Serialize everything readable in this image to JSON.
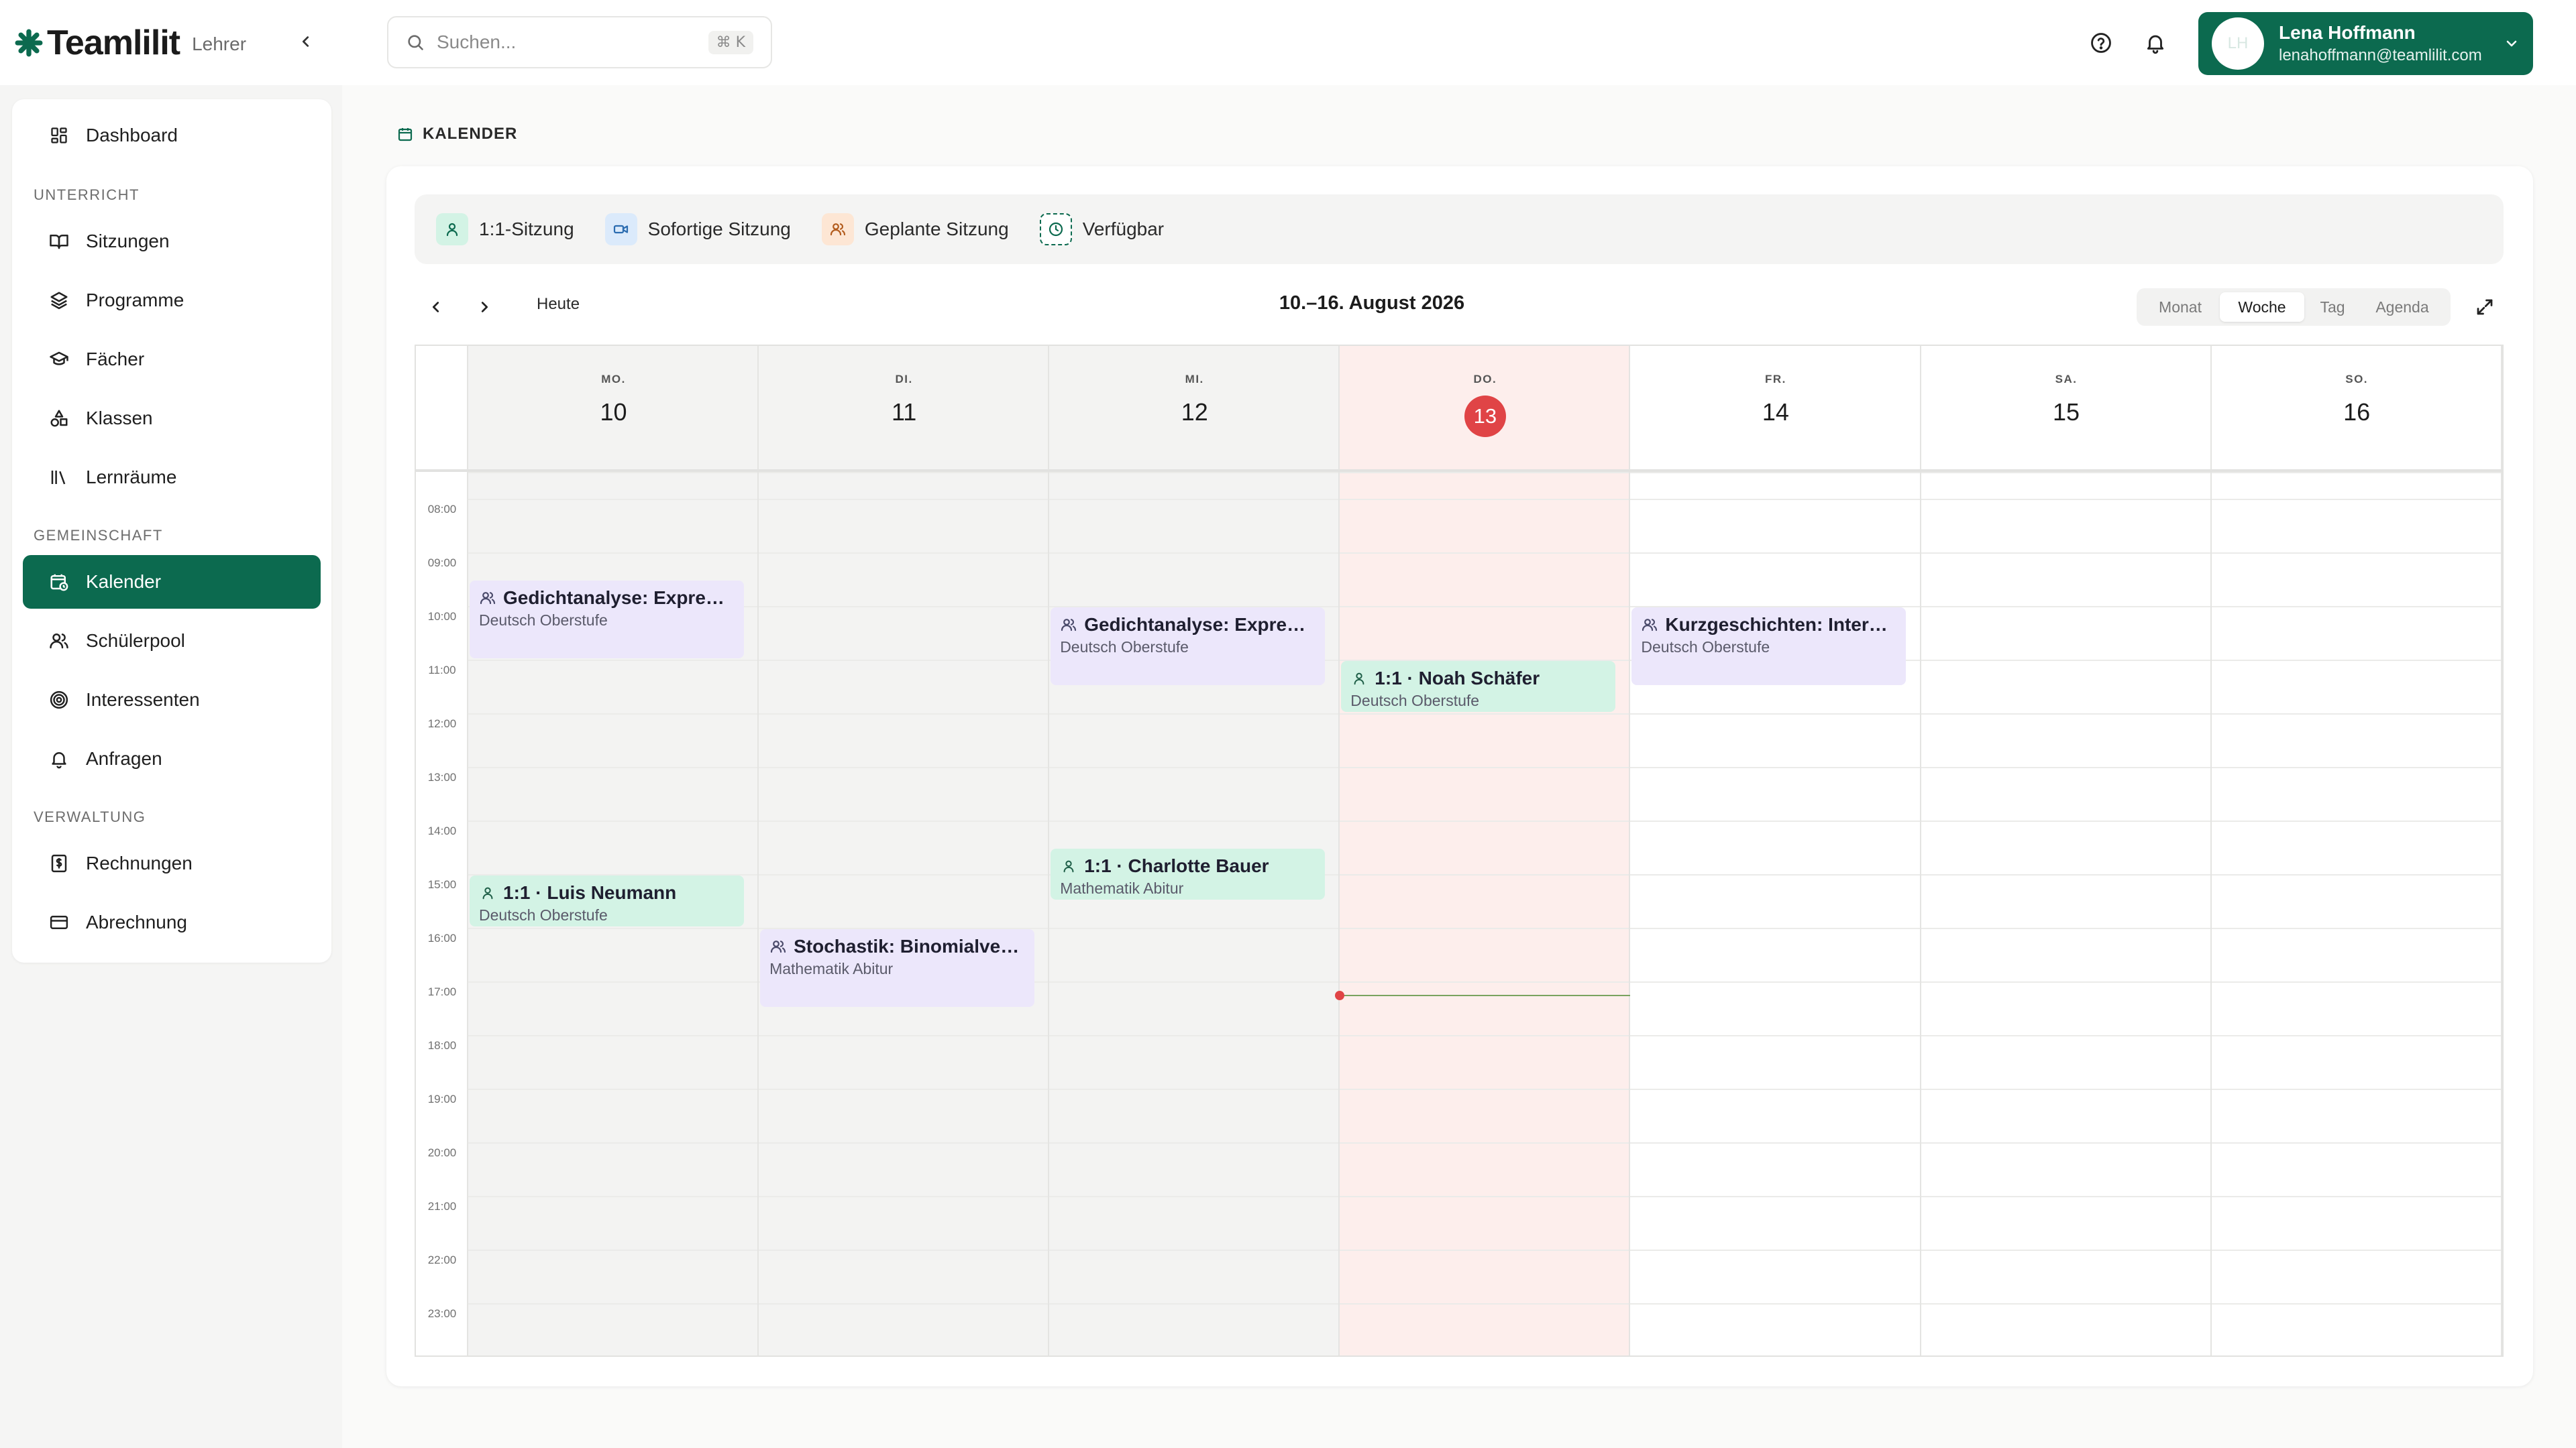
{
  "app": {
    "name": "Teamlilit",
    "role": "Lehrer"
  },
  "search": {
    "placeholder": "Suchen...",
    "shortcut": "⌘ K"
  },
  "user": {
    "initials": "LH",
    "name": "Lena Hoffmann",
    "email": "lenahoffmann@teamlilit.com"
  },
  "sidebar": {
    "top_items": [
      {
        "label": "Dashboard",
        "icon": "dashboard-icon"
      }
    ],
    "sections": [
      {
        "title": "UNTERRICHT",
        "items": [
          {
            "label": "Sitzungen",
            "icon": "book-open-icon"
          },
          {
            "label": "Programme",
            "icon": "layers-icon"
          },
          {
            "label": "Fächer",
            "icon": "graduation-cap-icon"
          },
          {
            "label": "Klassen",
            "icon": "shapes-icon"
          },
          {
            "label": "Lernräume",
            "icon": "library-icon"
          }
        ]
      },
      {
        "title": "GEMEINSCHAFT",
        "items": [
          {
            "label": "Kalender",
            "icon": "calendar-clock-icon",
            "active": true
          },
          {
            "label": "Schülerpool",
            "icon": "users-icon"
          },
          {
            "label": "Interessenten",
            "icon": "target-icon"
          },
          {
            "label": "Anfragen",
            "icon": "bell-icon"
          }
        ]
      },
      {
        "title": "VERWALTUNG",
        "items": [
          {
            "label": "Rechnungen",
            "icon": "receipt-icon"
          },
          {
            "label": "Abrechnung",
            "icon": "credit-card-icon"
          }
        ]
      }
    ]
  },
  "page": {
    "title": "KALENDER"
  },
  "legend": [
    {
      "label": "1:1-Sitzung",
      "icon": "user-icon"
    },
    {
      "label": "Sofortige Sitzung",
      "icon": "video-icon"
    },
    {
      "label": "Geplante Sitzung",
      "icon": "users-icon"
    },
    {
      "label": "Verfügbar",
      "icon": "clock-icon"
    }
  ],
  "toolbar": {
    "today_label": "Heute",
    "range_title": "10.–16. August 2026",
    "views": [
      "Monat",
      "Woche",
      "Tag",
      "Agenda"
    ],
    "active_view": "Woche"
  },
  "calendar": {
    "days": [
      {
        "name": "MO.",
        "num": "10"
      },
      {
        "name": "DI.",
        "num": "11"
      },
      {
        "name": "MI.",
        "num": "12"
      },
      {
        "name": "DO.",
        "num": "13",
        "today": true
      },
      {
        "name": "FR.",
        "num": "14"
      },
      {
        "name": "SA.",
        "num": "15"
      },
      {
        "name": "SO.",
        "num": "16"
      }
    ],
    "hours": [
      "08:00",
      "09:00",
      "10:00",
      "11:00",
      "12:00",
      "13:00",
      "14:00",
      "15:00",
      "16:00",
      "17:00",
      "18:00",
      "19:00",
      "20:00",
      "21:00",
      "22:00",
      "23:00"
    ],
    "now_time": "17:15",
    "events": [
      {
        "day": 0,
        "start": "09:30",
        "end": "11:00",
        "type": "group",
        "title": "Gedichtanalyse: Expressi...",
        "subtitle": "Deutsch Oberstufe"
      },
      {
        "day": 2,
        "start": "10:00",
        "end": "11:30",
        "type": "group",
        "title": "Gedichtanalyse: Expressi...",
        "subtitle": "Deutsch Oberstufe"
      },
      {
        "day": 3,
        "start": "11:00",
        "end": "12:00",
        "type": "single",
        "title": "1:1 · Noah Schäfer",
        "subtitle": "Deutsch Oberstufe"
      },
      {
        "day": 4,
        "start": "10:00",
        "end": "11:30",
        "type": "group",
        "title": "Kurzgeschichten: Interpr...",
        "subtitle": "Deutsch Oberstufe"
      },
      {
        "day": 2,
        "start": "14:30",
        "end": "15:30",
        "type": "single",
        "title": "1:1 · Charlotte Bauer",
        "subtitle": "Mathematik Abitur"
      },
      {
        "day": 0,
        "start": "15:00",
        "end": "16:00",
        "type": "single",
        "title": "1:1 · Luis Neumann",
        "subtitle": "Deutsch Oberstufe"
      },
      {
        "day": 1,
        "start": "16:00",
        "end": "17:30",
        "type": "group",
        "title": "Stochastik: Binomialvert...",
        "subtitle": "Mathematik Abitur"
      }
    ]
  },
  "colors": {
    "brand": "#0c6a4f",
    "today": "#e04446",
    "group_event": "#ece7fb",
    "single_event": "#d3f3e5",
    "today_column": "#fdeeec",
    "past_column": "#f3f3f2"
  }
}
